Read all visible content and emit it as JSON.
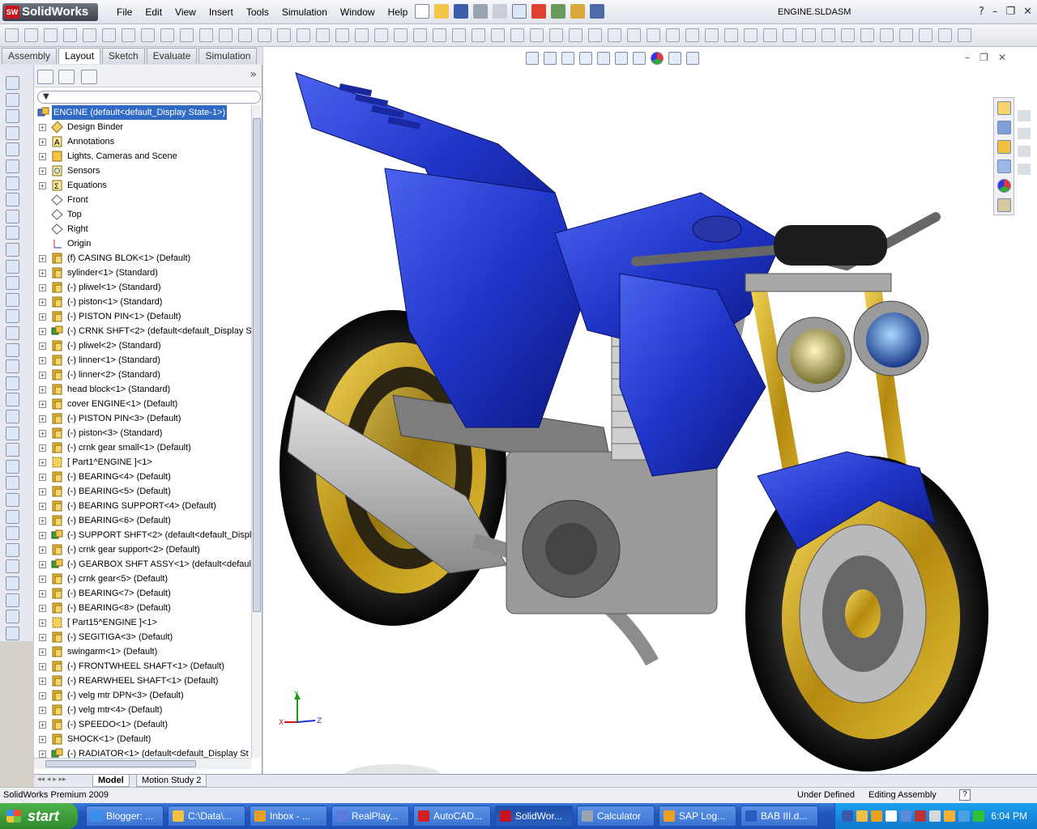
{
  "app": {
    "logo_text": "SolidWorks",
    "document_title": "ENGINE.SLDASM"
  },
  "menu": [
    "File",
    "Edit",
    "View",
    "Insert",
    "Tools",
    "Simulation",
    "Window",
    "Help"
  ],
  "command_tabs": [
    "Assembly",
    "Layout",
    "Sketch",
    "Evaluate",
    "Simulation"
  ],
  "active_command_tab": "Layout",
  "feature_tree": {
    "root": "ENGINE  (default<default_Display State-1>)",
    "items": [
      {
        "label": "Design Binder",
        "icon": "binder-icon"
      },
      {
        "label": "Annotations",
        "icon": "annotations-icon"
      },
      {
        "label": "Lights, Cameras and Scene",
        "icon": "lights-icon"
      },
      {
        "label": "Sensors",
        "icon": "sensor-icon"
      },
      {
        "label": "Equations",
        "icon": "equations-icon"
      },
      {
        "label": "Front",
        "icon": "plane-icon"
      },
      {
        "label": "Top",
        "icon": "plane-icon"
      },
      {
        "label": "Right",
        "icon": "plane-icon"
      },
      {
        "label": "Origin",
        "icon": "origin-icon"
      },
      {
        "label": "(f) CASING BLOK<1> (Default)",
        "icon": "part-icon"
      },
      {
        "label": "sylinder<1> (Standard)",
        "icon": "part-icon"
      },
      {
        "label": "(-) pliwel<1> (Standard)",
        "icon": "part-icon"
      },
      {
        "label": "(-) piston<1> (Standard)",
        "icon": "part-icon"
      },
      {
        "label": "(-) PISTON PIN<1> (Default)",
        "icon": "part-icon"
      },
      {
        "label": "(-) CRNK SHFT<2> (default<default_Display S",
        "icon": "subassembly-icon"
      },
      {
        "label": "(-) pliwel<2> (Standard)",
        "icon": "part-icon"
      },
      {
        "label": "(-) linner<1> (Standard)",
        "icon": "part-icon"
      },
      {
        "label": "(-) linner<2> (Standard)",
        "icon": "part-icon"
      },
      {
        "label": "head block<1> (Standard)",
        "icon": "part-icon"
      },
      {
        "label": "cover ENGINE<1> (Default)",
        "icon": "part-icon"
      },
      {
        "label": "(-) PISTON PIN<3> (Default)",
        "icon": "part-icon"
      },
      {
        "label": "(-) piston<3> (Standard)",
        "icon": "part-icon"
      },
      {
        "label": "(-) crnk gear small<1> (Default)",
        "icon": "part-icon"
      },
      {
        "label": "[ Part1^ENGINE ]<1>",
        "icon": "virtual-part-icon"
      },
      {
        "label": "(-) BEARING<4> (Default)",
        "icon": "part-icon"
      },
      {
        "label": "(-) BEARING<5> (Default)",
        "icon": "part-icon"
      },
      {
        "label": "(-) BEARING SUPPORT<4> (Default)",
        "icon": "part-icon"
      },
      {
        "label": "(-) BEARING<6> (Default)",
        "icon": "part-icon"
      },
      {
        "label": "(-) SUPPORT SHFT<2> (default<default_Displa",
        "icon": "subassembly-icon"
      },
      {
        "label": "(-) crnk gear support<2> (Default)",
        "icon": "part-icon"
      },
      {
        "label": "(-) GEARBOX SHFT ASSY<1> (default<default_",
        "icon": "subassembly-icon"
      },
      {
        "label": "(-) crnk gear<5> (Default)",
        "icon": "part-icon"
      },
      {
        "label": "(-) BEARING<7> (Default)",
        "icon": "part-icon"
      },
      {
        "label": "(-) BEARING<8> (Default)",
        "icon": "part-icon"
      },
      {
        "label": "[ Part15^ENGINE ]<1>",
        "icon": "virtual-part-icon"
      },
      {
        "label": "(-) SEGITIGA<3> (Default)",
        "icon": "part-icon"
      },
      {
        "label": "swingarm<1> (Default)",
        "icon": "part-icon"
      },
      {
        "label": "(-) FRONTWHEEL SHAFT<1> (Default)",
        "icon": "part-icon"
      },
      {
        "label": "(-) REARWHEEL SHAFT<1> (Default)",
        "icon": "part-icon"
      },
      {
        "label": "(-) velg mtr DPN<3> (Default)",
        "icon": "part-icon"
      },
      {
        "label": "(-) velg mtr<4> (Default)",
        "icon": "part-icon"
      },
      {
        "label": "(-) SPEEDO<1> (Default)",
        "icon": "part-icon"
      },
      {
        "label": "SHOCK<1> (Default)",
        "icon": "part-icon"
      },
      {
        "label": "(-) RADIATOR<1> (default<default_Display St",
        "icon": "subassembly-icon"
      }
    ]
  },
  "bottom_tabs": [
    "Model",
    "Motion Study 2"
  ],
  "status": {
    "product": "SolidWorks Premium 2009",
    "definition": "Under Defined",
    "mode": "Editing Assembly",
    "help": "?"
  },
  "triad": {
    "x": "X",
    "y": "Y",
    "z": "Z"
  },
  "taskbar": {
    "start_label": "start",
    "items": [
      "Blogger: ...",
      "C:\\Data\\...",
      "Inbox - ...",
      "RealPlay...",
      "AutoCAD...",
      "SolidWor...",
      "Calculator",
      "SAP Log...",
      "BAB III.d..."
    ],
    "active_item": "SolidWor...",
    "clock": "6:04 PM"
  },
  "colors": {
    "body_blue": "#1f35c8",
    "rim_gold": "#c9a318",
    "selection": "#316ac5",
    "taskbar_blue": "#2256c0",
    "start_green": "#3a9a36"
  }
}
